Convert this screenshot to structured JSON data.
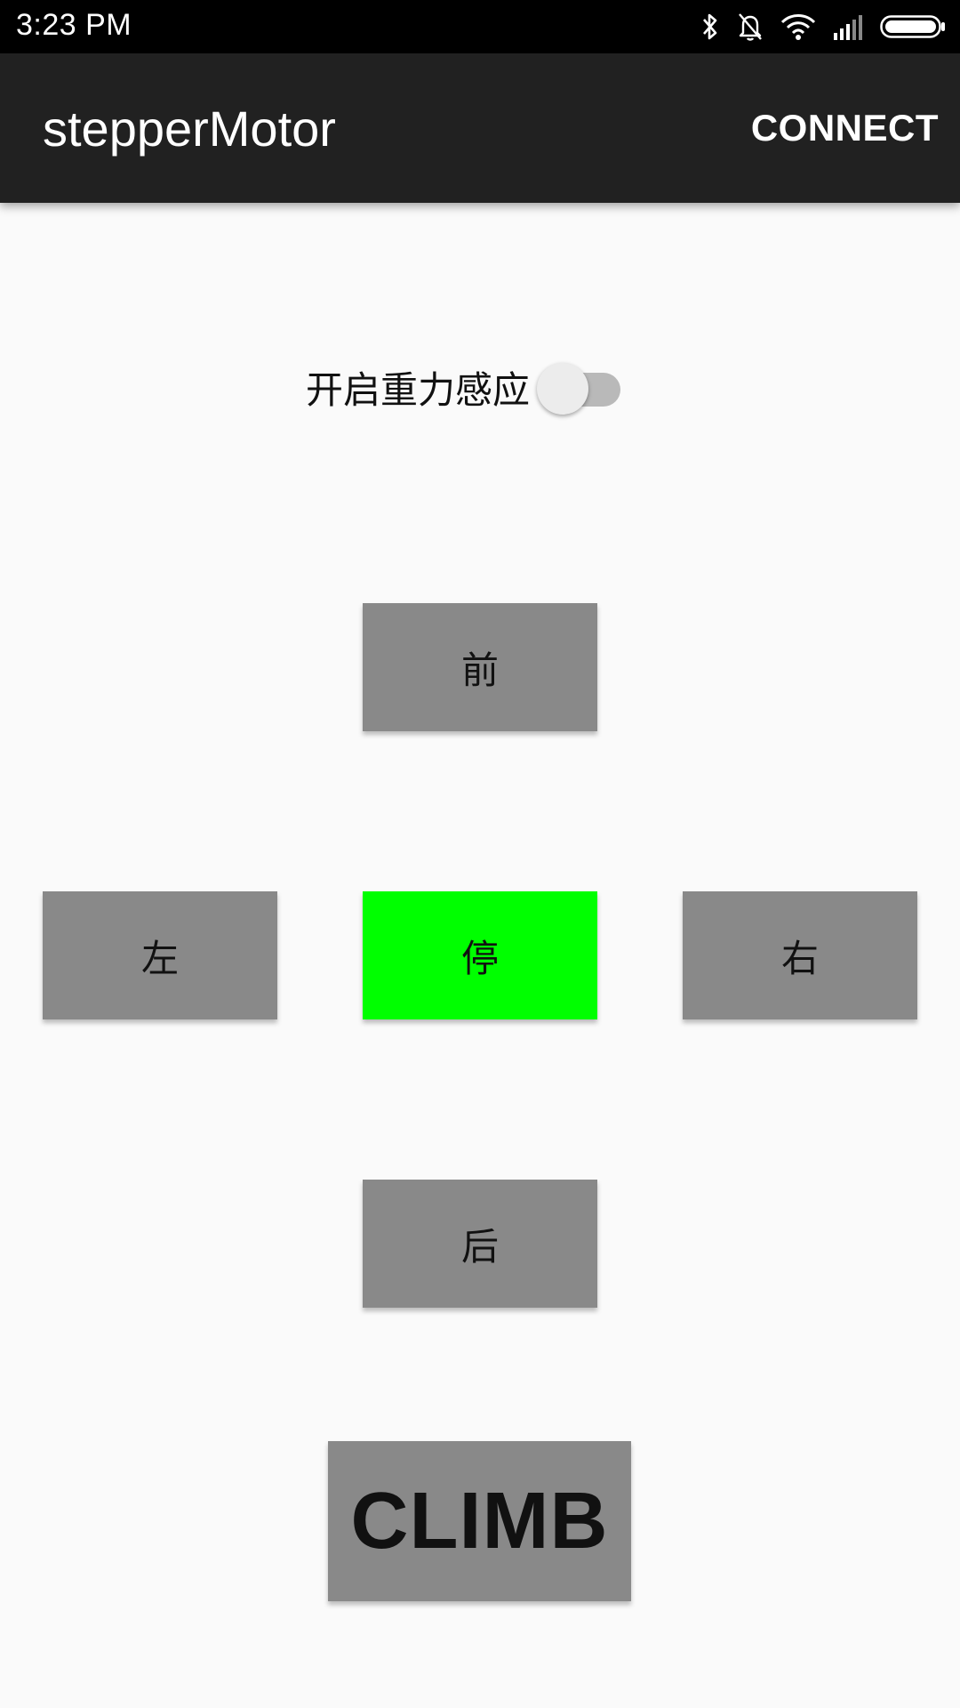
{
  "status_bar": {
    "time": "3:23 PM",
    "icons": [
      "bluetooth-icon",
      "notifications-off-icon",
      "wifi-icon",
      "signal-icon",
      "battery-icon"
    ]
  },
  "app_bar": {
    "title": "stepperMotor",
    "connect_label": "CONNECT"
  },
  "gravity": {
    "label": "开启重力感应",
    "enabled": false
  },
  "controls": {
    "forward": "前",
    "left": "左",
    "stop": "停",
    "right": "右",
    "back": "后",
    "climb": "CLIMB"
  },
  "colors": {
    "app_bar": "#212121",
    "button": "#898989",
    "stop_button": "#00ff00",
    "background": "#fafafa"
  }
}
